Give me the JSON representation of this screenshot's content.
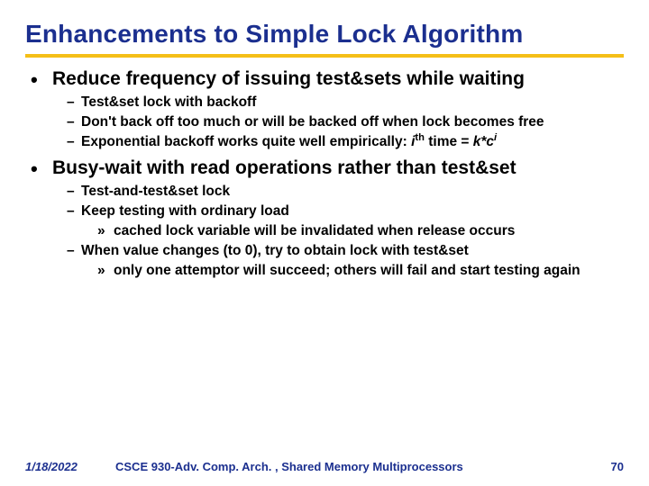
{
  "title": "Enhancements to Simple Lock Algorithm",
  "b1": "Reduce frequency of issuing test&sets while waiting",
  "b1s1": "Test&set lock with backoff",
  "b1s2": "Don't back off too much or will be backed off when lock becomes free",
  "b1s3a": "Exponential backoff works quite well empirically: ",
  "b1s3_i": "i",
  "b1s3_th": "th",
  "b1s3b": " time = ",
  "b1s3_k": "k*c",
  "b1s3_iexp": "i",
  "b2": "Busy-wait with read operations rather than test&set",
  "b2s1": "Test-and-test&set lock",
  "b2s2": "Keep testing with ordinary load",
  "b2s2a": "cached lock variable will be invalidated when release occurs",
  "b2s3": "When value changes (to 0), try to obtain lock with test&set",
  "b2s3a": "only one attemptor will succeed; others will fail and start testing again",
  "footer": {
    "date": "1/18/2022",
    "course": "CSCE 930-Adv. Comp. Arch. , Shared Memory Multiprocessors",
    "page": "70"
  }
}
